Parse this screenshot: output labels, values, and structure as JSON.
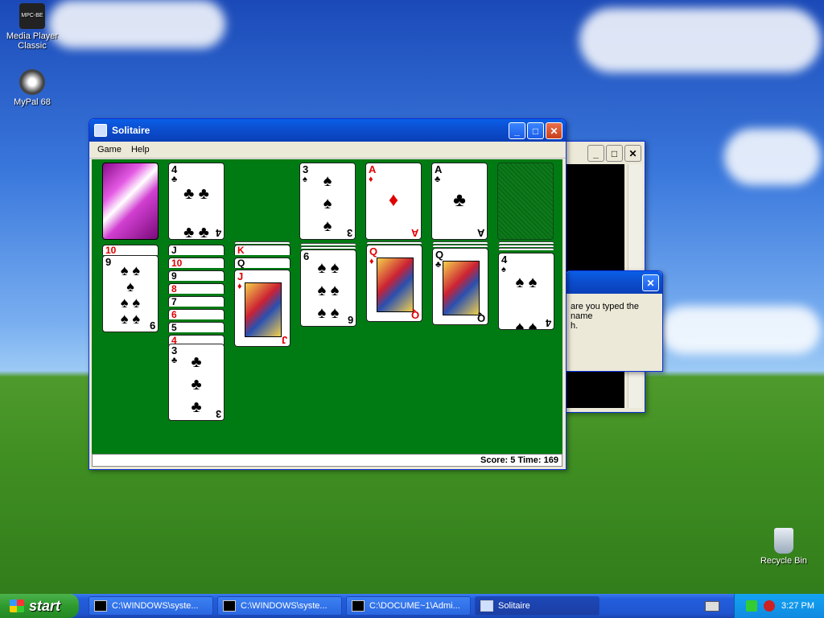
{
  "desktop": {
    "icons": [
      {
        "label_line1": "Media Player",
        "label_line2": "Classic",
        "badge": "MPC-BE"
      },
      {
        "label": "MyPal 68"
      },
      {
        "label": "Recycle Bin"
      }
    ]
  },
  "solitaire": {
    "title": "Solitaire",
    "menu": [
      "Game",
      "Help"
    ],
    "status": "Score: 5 Time: 169",
    "top_cards": [
      {
        "rank": "4",
        "suit": "♣",
        "color": "black"
      },
      {
        "rank": "3",
        "suit": "♠",
        "color": "black"
      },
      {
        "rank": "A",
        "suit": "♦",
        "color": "red"
      },
      {
        "rank": "A",
        "suit": "♣",
        "color": "black"
      }
    ],
    "tableau_stubs": {
      "col1": [
        "10"
      ],
      "col2": [
        "J",
        "10",
        "9",
        "8",
        "7",
        "6",
        "5",
        "4"
      ],
      "col3": [
        "K",
        "Q"
      ]
    },
    "tableau_faces": [
      {
        "rank": "9",
        "suit": "♠",
        "color": "black"
      },
      {
        "rank": "3",
        "suit": "♣",
        "color": "black"
      },
      {
        "rank": "J",
        "suit": "♦",
        "color": "red"
      },
      {
        "rank": "6",
        "suit": "♠",
        "color": "black"
      },
      {
        "rank": "Q",
        "suit": "♦",
        "color": "red"
      },
      {
        "rank": "Q",
        "suit": "♣",
        "color": "black"
      },
      {
        "rank": "4",
        "suit": "♠",
        "color": "black"
      }
    ]
  },
  "dialog": {
    "text_line1": "are you typed the name",
    "text_line2": "h."
  },
  "taskbar": {
    "start": "start",
    "tasks": [
      "C:\\WINDOWS\\syste...",
      "C:\\WINDOWS\\syste...",
      "C:\\DOCUME~1\\Admi...",
      "Solitaire"
    ],
    "clock": "3:27 PM"
  },
  "colors": {
    "felt": "#007a12",
    "title_blue": "#0b4fd0",
    "card_red": "#e00000"
  }
}
